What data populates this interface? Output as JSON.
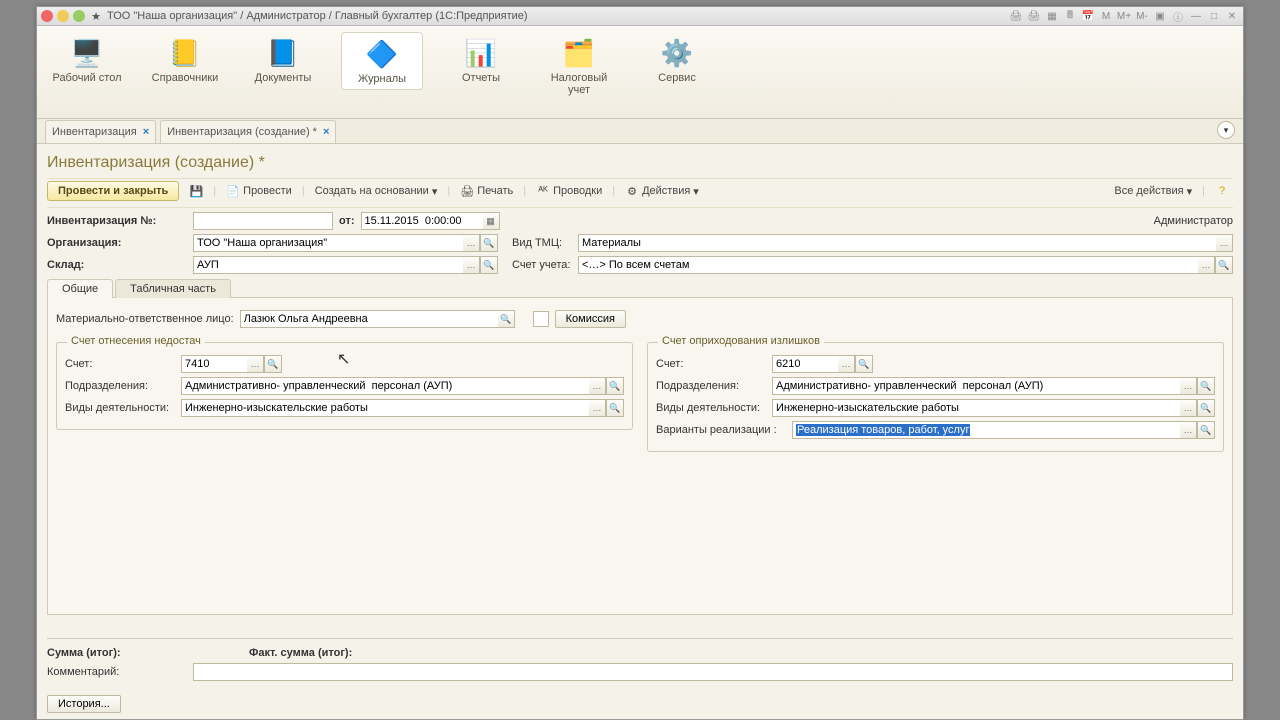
{
  "title": "ТОО \"Наша организация\" / Администратор / Главный бухгалтер  (1С:Предприятие)",
  "nav": [
    {
      "label": "Рабочий стол",
      "icon": "🖥️"
    },
    {
      "label": "Справочники",
      "icon": "📒"
    },
    {
      "label": "Документы",
      "icon": "📘"
    },
    {
      "label": "Журналы",
      "icon": "🔷",
      "active": true
    },
    {
      "label": "Отчеты",
      "icon": "📊"
    },
    {
      "label": "Налоговый учет",
      "icon": "🗂️"
    },
    {
      "label": "Сервис",
      "icon": "⚙️"
    }
  ],
  "doctabs": [
    {
      "label": "Инвентаризация"
    },
    {
      "label": "Инвентаризация (создание) *"
    }
  ],
  "page_title": "Инвентаризация (создание) *",
  "tb": {
    "post_close": "Провести и закрыть",
    "post": "Провести",
    "create_based": "Создать на основании",
    "print": "Печать",
    "entries": "Проводки",
    "actions": "Действия",
    "all_actions": "Все действия",
    "user": "Администратор"
  },
  "f": {
    "num_lbl": "Инвентаризация №:",
    "num": "",
    "from_lbl": "от:",
    "from": "15.11.2015  0:00:00",
    "org_lbl": "Организация:",
    "org": "ТОО \"Наша организация\"",
    "tmc_lbl": "Вид ТМЦ:",
    "tmc": "Материалы",
    "wh_lbl": "Склад:",
    "wh": "АУП",
    "acc_lbl": "Счет учета:",
    "acc": "<…> По всем счетам"
  },
  "subtabs": {
    "general": "Общие",
    "table": "Табличная часть"
  },
  "g": {
    "mol_lbl": "Материально-ответственное лицо:",
    "mol": "Лазюк Ольга Андреевна",
    "commission": "Комиссия"
  },
  "left": {
    "legend": "Счет отнесения недостач",
    "acc_lbl": "Счет:",
    "acc": "7410",
    "dep_lbl": "Подразделения:",
    "dep": "Административно- управленческий  персонал (АУП)",
    "act_lbl": "Виды деятельности:",
    "act": "Инженерно-изыскательские работы"
  },
  "right": {
    "legend": "Счет оприходования излишков",
    "acc_lbl": "Счет:",
    "acc": "6210",
    "dep_lbl": "Подразделения:",
    "dep": "Административно- управленческий  персонал (АУП)",
    "act_lbl": "Виды деятельности:",
    "act": "Инженерно-изыскательские работы",
    "var_lbl": "Варианты реализации :",
    "var": "Реализация товаров, работ, услуг"
  },
  "bottom": {
    "sum_lbl": "Сумма (итог):",
    "fact_lbl": "Факт. сумма (итог):",
    "comment_lbl": "Комментарий:",
    "comment": ""
  },
  "history": "История..."
}
